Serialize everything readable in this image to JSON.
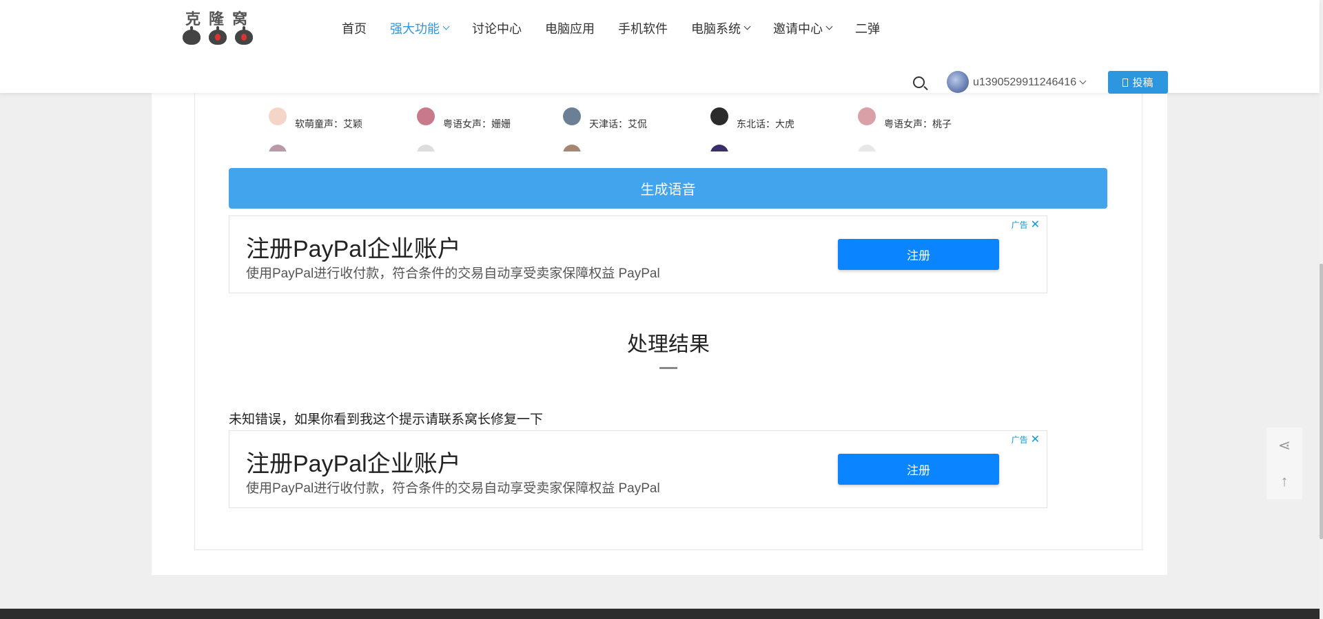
{
  "header": {
    "logo_text": "克隆窝",
    "nav": [
      {
        "label": "首页",
        "dropdown": false,
        "active": false
      },
      {
        "label": "强大功能",
        "dropdown": true,
        "active": true
      },
      {
        "label": "讨论中心",
        "dropdown": false,
        "active": false
      },
      {
        "label": "电脑应用",
        "dropdown": false,
        "active": false
      },
      {
        "label": "手机软件",
        "dropdown": false,
        "active": false
      },
      {
        "label": "电脑系统",
        "dropdown": true,
        "active": false
      },
      {
        "label": "邀请中心",
        "dropdown": true,
        "active": false
      },
      {
        "label": "二弹",
        "dropdown": false,
        "active": false
      }
    ],
    "username": "u1390529911246416",
    "post_button": "投稿"
  },
  "voices": [
    {
      "label": "软萌童声：艾颖",
      "color": "#f3d6c8"
    },
    {
      "label": "粤语女声：姗姗",
      "color": "#c97a8a"
    },
    {
      "label": "天津话：艾侃",
      "color": "#6b7f95"
    },
    {
      "label": "东北话：大虎",
      "color": "#2b2b2b"
    },
    {
      "label": "粤语女声：桃子",
      "color": "#d9a0a7"
    }
  ],
  "generate_button": "生成语音",
  "ads": [
    {
      "title": "注册PayPal企业账户",
      "desc": "使用PayPal进行收付款，符合条件的交易自动享受卖家保障权益 PayPal",
      "button": "注册",
      "badge": "广告"
    },
    {
      "title": "注册PayPal企业账户",
      "desc": "使用PayPal进行收付款，符合条件的交易自动享受卖家保障权益 PayPal",
      "button": "注册",
      "badge": "广告"
    }
  ],
  "result": {
    "title": "处理结果",
    "message": "未知错误，如果你看到我这个提示请联系窝长修复一下"
  },
  "colors": {
    "accent": "#2c97de",
    "generate": "#42a4ec",
    "ad_button": "#0a84ff"
  }
}
